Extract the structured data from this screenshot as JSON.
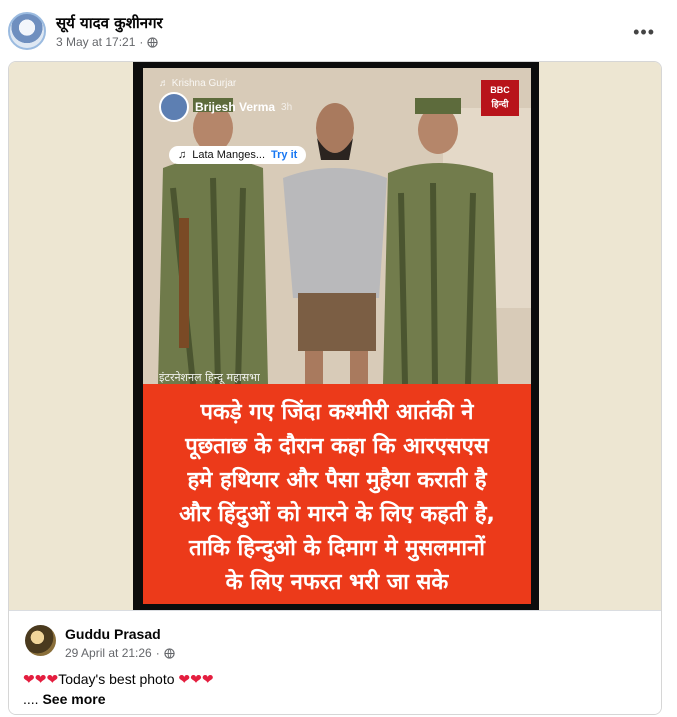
{
  "post": {
    "author": "सूर्य यादव कुशीनगर",
    "timestamp": "3 May at 17:21",
    "separator": "·",
    "privacy_icon": "globe-icon",
    "more_icon": "more-horizontal-icon",
    "more_label": "•••"
  },
  "media": {
    "overlay_handle": "♬ Krishna Gurjar",
    "overlay_user": "Brijesh Verma",
    "overlay_time": "3h",
    "music_note": "♫",
    "music_title": "Lata Manges...",
    "music_action": "Try it",
    "logo_top": "BBC",
    "logo_bottom": "हिन्दी",
    "watermark": "इंटरनेशनल हिन्दू महासभा",
    "headline": "पकड़े गए जिंदा कश्मीरी आतंकी ने\nपूछताछ के दौरान कहा कि आरएसएस\nहमे हथियार और पैसा मुहैया कराती है\nऔर हिंदुओं को मारने के लिए कहती है,\nताकि हिन्दुओ के दिमाग मे मुसलमानों\nके लिए नफरत भरी जा सके"
  },
  "comment": {
    "author": "Guddu Prasad",
    "timestamp": "29 April at 21:26",
    "separator": "·",
    "privacy_icon": "globe-icon",
    "hearts_before": "❤❤❤",
    "text": "Today's best photo",
    "hearts_after": "❤❤❤",
    "ellipsis": "....",
    "see_more": "See more"
  },
  "colors": {
    "accent": "#1877f2",
    "banner_red": "#ec3a1a",
    "card_bg": "#ede6d2",
    "heart": "#e41e3f"
  }
}
